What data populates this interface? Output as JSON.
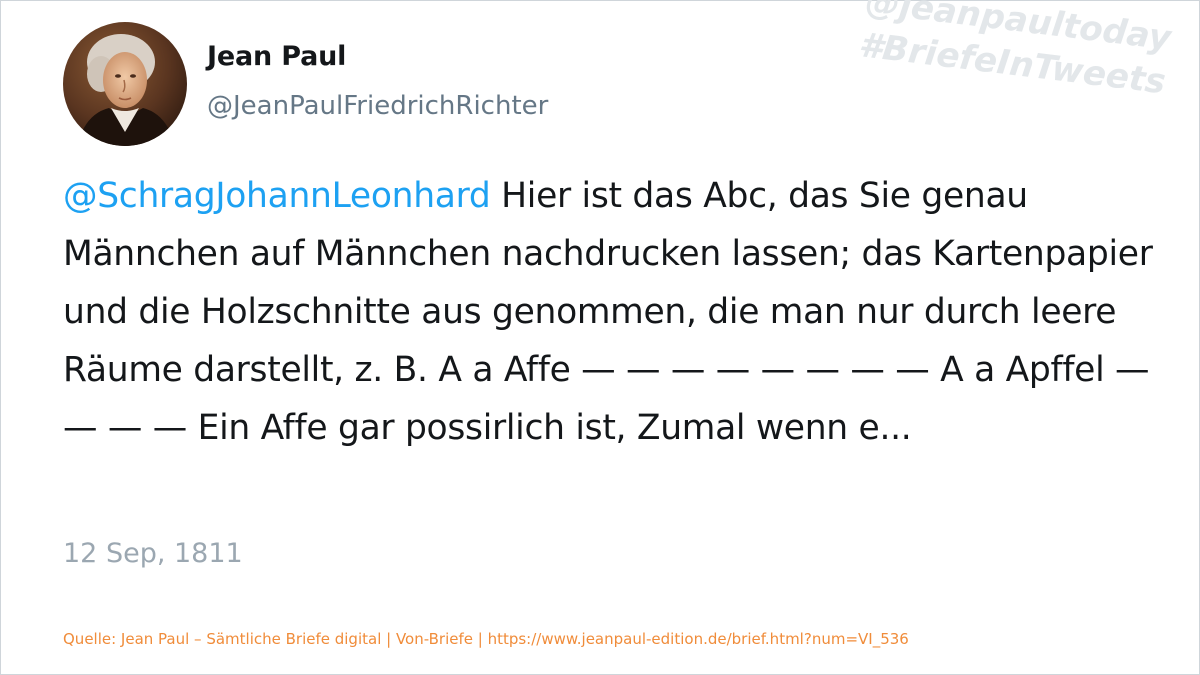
{
  "author": {
    "name": "Jean Paul",
    "handle": "@JeanPaulFriedrichRichter"
  },
  "watermark": {
    "line1": "@jeanpaultoday",
    "line2": "#BriefeInTweets"
  },
  "tweet": {
    "mention": "@SchragJohannLeonhard",
    "text": " Hier ist das Abc, das Sie genau Männchen auf Männchen nachdrucken lassen; das Kartenpapier und die Holzschnitte aus genommen, die man nur durch leere Räume darstellt, z. B. A a Affe — — — — — — — — A a Apffel — — — — Ein Affe gar possirlich ist, Zumal wenn e...",
    "date": "12 Sep, 1811"
  },
  "source": "Quelle: Jean Paul – Sämtliche Briefe digital | Von-Briefe | https://www.jeanpaul-edition.de/brief.html?num=VI_536",
  "colors": {
    "mention": "#1da1f2",
    "text": "#14171a",
    "handle": "#657786",
    "date": "#9ba7b1",
    "source": "#f08c3a",
    "watermark": "#e3e7ea"
  }
}
